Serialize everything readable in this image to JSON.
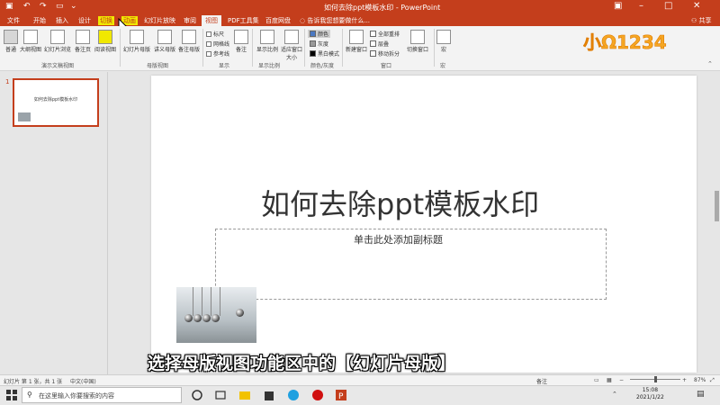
{
  "window": {
    "title": "如何去除ppt模板水印 - PowerPoint"
  },
  "tabs": [
    "文件",
    "开始",
    "插入",
    "设计",
    "切换",
    "动画",
    "幻灯片放映",
    "审阅",
    "视图",
    "PDF工具集",
    "百度网盘"
  ],
  "active_tab": "视图",
  "tell_me": "告诉我您想要做什么...",
  "share": "共享",
  "ribbon": {
    "presentation_views": {
      "group_label": "演示文稿视图",
      "buttons": [
        "普通",
        "大纲视图",
        "幻灯片浏览",
        "备注页",
        "阅读视图"
      ]
    },
    "master_views": {
      "group_label": "母版视图",
      "buttons": [
        "幻灯片母版",
        "讲义母版",
        "备注母版"
      ]
    },
    "show": {
      "group_label": "显示",
      "items": [
        "标尺",
        "网格线",
        "参考线"
      ]
    },
    "notes": "备注",
    "zoom": {
      "group_label": "显示比例",
      "buttons": [
        "显示比例",
        "适应窗口大小"
      ]
    },
    "color": {
      "group_label": "颜色/灰度",
      "items": [
        "颜色",
        "灰度",
        "黑白模式"
      ]
    },
    "window": {
      "group_label": "窗口",
      "new_window": "新建窗口",
      "items": [
        "全部重排",
        "层叠",
        "移动拆分"
      ],
      "switch": "切换窗口"
    },
    "macro": {
      "group_label": "宏",
      "button": "宏"
    }
  },
  "watermark_logo": "小Ω1234",
  "thumbnail": {
    "number": "1",
    "title": "如何去除ppt模板水印"
  },
  "slide": {
    "title": "如何去除ppt模板水印",
    "subtitle_placeholder": "单击此处添加副标题"
  },
  "caption": "选择母版视图功能区中的【幻灯片母版】",
  "status": {
    "slide_info": "幻灯片 第 1 张，共 1 张",
    "language": "中文(中国)",
    "notes": "备注",
    "zoom": "87%"
  },
  "taskbar": {
    "search_placeholder": "在这里输入你要搜索的内容",
    "time": "15:08",
    "date": "2021/1/22"
  },
  "colors": {
    "accent": "#c43e1c",
    "ribbon_bg": "#f3f3f3",
    "highlight": "#f0e800"
  }
}
